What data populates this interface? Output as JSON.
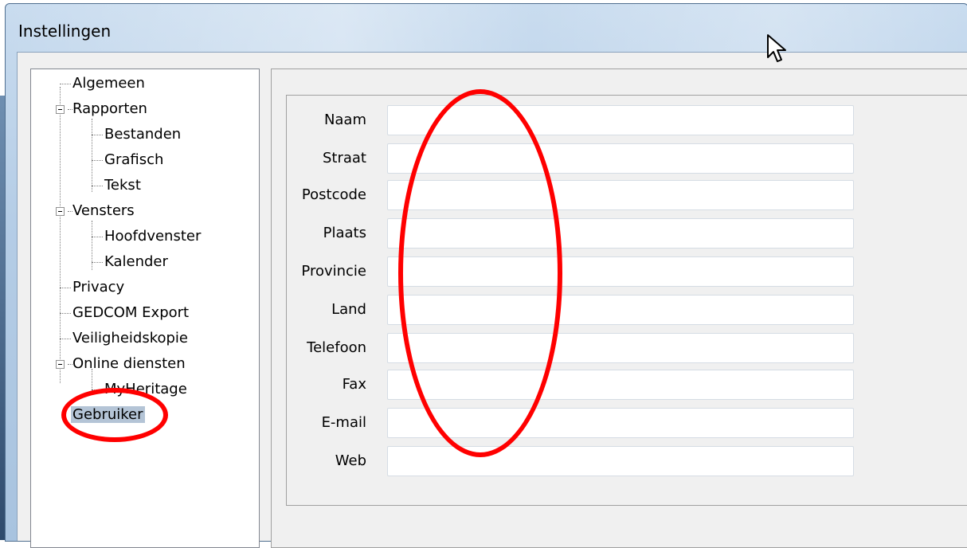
{
  "window": {
    "title": "Instellingen"
  },
  "tree": {
    "items": [
      {
        "label": "Algemeen"
      },
      {
        "label": "Rapporten"
      },
      {
        "label": "Bestanden"
      },
      {
        "label": "Grafisch"
      },
      {
        "label": "Tekst"
      },
      {
        "label": "Vensters"
      },
      {
        "label": "Hoofdvenster"
      },
      {
        "label": "Kalender"
      },
      {
        "label": "Privacy"
      },
      {
        "label": "GEDCOM Export"
      },
      {
        "label": "Veiligheidskopie"
      },
      {
        "label": "Online diensten"
      },
      {
        "label": "MyHeritage"
      },
      {
        "label": "Gebruiker"
      }
    ],
    "selected": "Gebruiker"
  },
  "form": {
    "fields": [
      {
        "label": "Naam",
        "value": ""
      },
      {
        "label": "Straat",
        "value": ""
      },
      {
        "label": "Postcode",
        "value": ""
      },
      {
        "label": "Plaats",
        "value": ""
      },
      {
        "label": "Provincie",
        "value": ""
      },
      {
        "label": "Land",
        "value": ""
      },
      {
        "label": "Telefoon",
        "value": ""
      },
      {
        "label": "Fax",
        "value": ""
      },
      {
        "label": "E-mail",
        "value": ""
      },
      {
        "label": "Web",
        "value": ""
      }
    ]
  },
  "colors": {
    "annotation": "#ff0000",
    "selection": "#b4c4d6"
  }
}
